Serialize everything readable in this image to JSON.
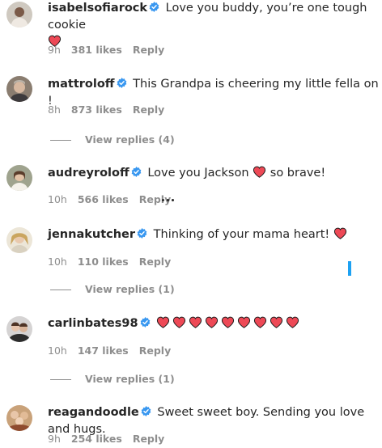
{
  "colors": {
    "verified": "#3897f0",
    "heart": "#ed4956",
    "secondary": "#8e8e8e",
    "accent": "#1da1f2"
  },
  "comments": [
    {
      "username": "isabelsofiarock",
      "text": "Love you buddy, you’re one tough cookie",
      "time": "9h",
      "likes": "381 likes",
      "reply": "Reply"
    },
    {
      "username": "mattroloff",
      "text": "This Grandpa is cheering my little fella on !",
      "time": "8h",
      "likes": "873 likes",
      "reply": "Reply",
      "view_replies": "View replies (4)"
    },
    {
      "username": "audreyroloff",
      "text_before": "Love you Jackson",
      "text_after": "so brave!",
      "time": "10h",
      "likes": "566 likes",
      "reply": "Reply"
    },
    {
      "username": "jennakutcher",
      "text": "Thinking of your mama heart!",
      "time": "10h",
      "likes": "110 likes",
      "reply": "Reply",
      "view_replies": "View replies (1)"
    },
    {
      "username": "carlinbates98",
      "time": "10h",
      "likes": "147 likes",
      "reply": "Reply",
      "view_replies": "View replies (1)"
    },
    {
      "username": "reagandoodle",
      "text": "Sweet sweet boy. Sending you love and hugs.",
      "time": "9h",
      "likes": "254 likes",
      "reply": "Reply"
    }
  ]
}
